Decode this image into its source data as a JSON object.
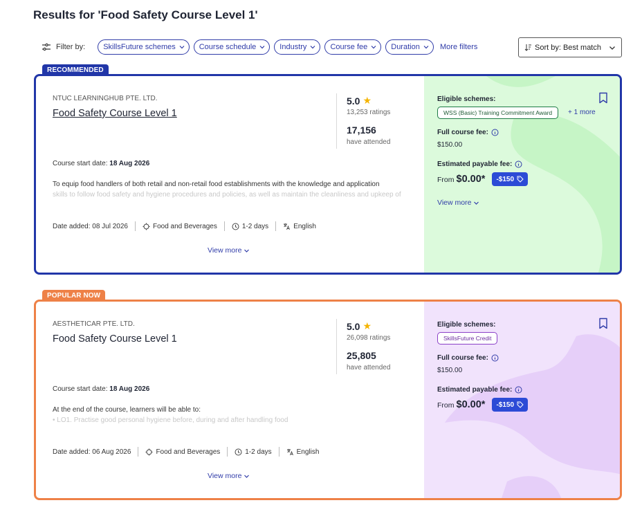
{
  "page": {
    "title": "Results for 'Food Safety Course Level 1'"
  },
  "filters": {
    "label": "Filter by:",
    "chips": [
      "SkillsFuture schemes",
      "Course schedule",
      "Industry",
      "Course fee",
      "Duration"
    ],
    "more": "More filters"
  },
  "sort": {
    "label": "Sort by: Best match"
  },
  "courses": [
    {
      "tag": "RECOMMENDED",
      "provider": "NTUC LEARNINGHUB PTE. LTD.",
      "name": "Food Safety Course Level 1",
      "rating": "5.0",
      "ratings_count": "13,253 ratings",
      "attended": "17,156",
      "attended_label": "have attended",
      "start_date_label": "Course start date:",
      "start_date": "18 Aug 2026",
      "desc_line1": "To equip food handlers of both retail and non-retail food establishments with the knowledge and application",
      "desc_line2": "skills to follow food safety and hygiene procedures and policies, as well as maintain the cleanliness and upkeep of",
      "date_added": "Date added: 08 Jul 2026",
      "industry": "Food and Beverages",
      "duration": "1-2 days",
      "language": "English",
      "view_more": "View more",
      "eligible_label": "Eligible schemes:",
      "scheme": "WSS (Basic) Training Commitment Award",
      "scheme_more": "+ 1 more",
      "full_fee_label": "Full course fee:",
      "full_fee": "$150.00",
      "est_label": "Estimated payable fee:",
      "from": "From",
      "est_fee": "$0.00*",
      "discount": "-$150",
      "panel_view_more": "View more",
      "panel_color": "#dcfadc",
      "blob_color": "#c6f5c6"
    },
    {
      "tag": "POPULAR NOW",
      "provider": "AESTHETICAR PTE. LTD.",
      "name": "Food Safety Course Level 1",
      "rating": "5.0",
      "ratings_count": "26,098 ratings",
      "attended": "25,805",
      "attended_label": "have attended",
      "start_date_label": "Course start date:",
      "start_date": "18 Aug 2026",
      "desc_line1": "At the end of the course, learners will be able to:",
      "desc_line2": "• LO1. Practise good personal hygiene before, during and after handling food",
      "date_added": "Date added: 06 Aug 2026",
      "industry": "Food and Beverages",
      "duration": "1-2 days",
      "language": "English",
      "view_more": "View more",
      "eligible_label": "Eligible schemes:",
      "scheme": "SkillsFuture Credit",
      "full_fee_label": "Full course fee:",
      "full_fee": "$150.00",
      "est_label": "Estimated payable fee:",
      "from": "From",
      "est_fee": "$0.00*",
      "discount": "-$150",
      "panel_color": "#f1e3fc",
      "blob_color": "#e6cff9"
    }
  ],
  "colors": {
    "recommended": "#2136a8",
    "popular": "#ee8147",
    "link": "#2f3ba8",
    "discount": "#2c4bd6"
  }
}
